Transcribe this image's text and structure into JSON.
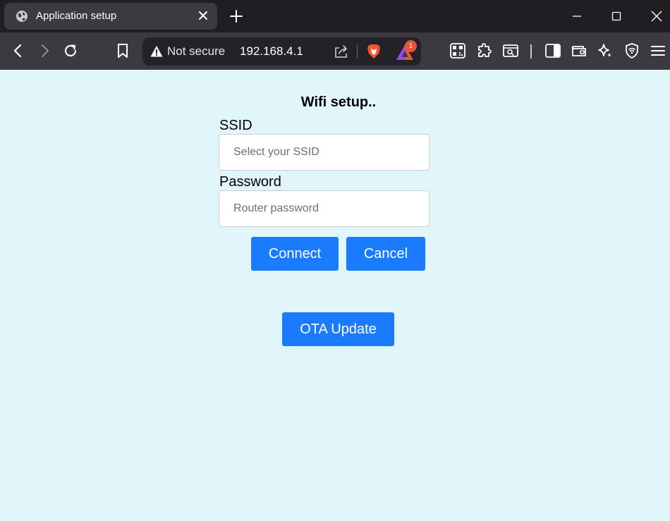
{
  "browser": {
    "tab": {
      "title": "Application setup",
      "favicon": "globe-icon",
      "close_icon": "close-icon"
    },
    "new_tab_icon": "plus-icon",
    "window_controls": [
      "minimize-icon",
      "maximize-icon",
      "close-icon"
    ],
    "toolbar": {
      "nav_icons": [
        "back-icon",
        "forward-icon",
        "reload-icon",
        "bookmark-icon"
      ],
      "security_label": "Not secure",
      "url": "192.168.4.1",
      "rewards_badge": "1",
      "right_icons": [
        "qr-code-icon",
        "extensions-icon",
        "reader-mode-icon",
        "sidebar-icon",
        "wallet-icon",
        "leo-ai-icon",
        "vpn-shield-icon",
        "menu-icon"
      ]
    },
    "colors": {
      "tabstrip_bg": "#1f1f23",
      "toolbar_bg": "#3a3a40",
      "page_bg": "#e0f6fa",
      "button_bg": "#1a7bff"
    }
  },
  "page": {
    "heading": "Wifi setup..",
    "ssid": {
      "label": "SSID",
      "placeholder": "Select your SSID",
      "value": ""
    },
    "password": {
      "label": "Password",
      "placeholder": "Router password",
      "value": ""
    },
    "buttons": {
      "connect": "Connect",
      "cancel": "Cancel",
      "ota_update": "OTA Update"
    }
  }
}
